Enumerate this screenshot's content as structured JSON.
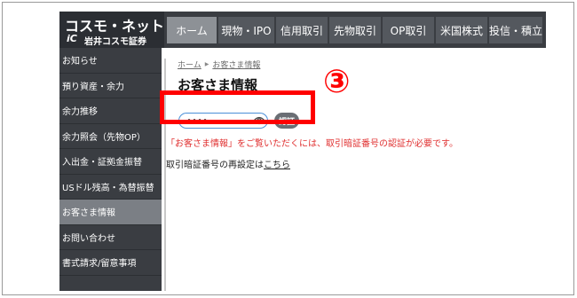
{
  "logo": {
    "main": "コスモ・ネットレ",
    "mark": "iC",
    "sub": "岩井コスモ証券"
  },
  "nav": {
    "tabs": [
      {
        "label": "ホーム",
        "active": true
      },
      {
        "label": "現物・IPO",
        "active": false
      },
      {
        "label": "信用取引",
        "active": false
      },
      {
        "label": "先物取引",
        "active": false
      },
      {
        "label": "OP取引",
        "active": false
      },
      {
        "label": "米国株式",
        "active": false
      },
      {
        "label": "投信・積立",
        "active": false
      }
    ]
  },
  "sidebar": {
    "items": [
      {
        "label": "お知らせ",
        "active": false
      },
      {
        "label": "預り資産・余力",
        "active": false
      },
      {
        "label": "余力推移",
        "active": false
      },
      {
        "label": "余力照会（先物OP）",
        "active": false
      },
      {
        "label": "入出金・証拠金振替",
        "active": false
      },
      {
        "label": "USドル残高・為替振替",
        "active": false
      },
      {
        "label": "お客さま情報",
        "active": true
      },
      {
        "label": "お問い合わせ",
        "active": false
      },
      {
        "label": "書式請求/留意事項",
        "active": false
      }
    ]
  },
  "main": {
    "breadcrumb": [
      "ホーム",
      "お客さま情報"
    ],
    "breadcrumb_separator": "▶",
    "title": "お客さま情報",
    "password_value": "••••",
    "auth_button": "認証",
    "error_message": "「お客さま情報」をご覧いただくには、取引暗証番号の認証が必要です。",
    "reset_prefix": "取引暗証番号の再設定は",
    "reset_link": "こちら"
  },
  "annotation": {
    "step": "③"
  },
  "colors": {
    "header_bg": "#3a3d42",
    "tab_bg": "#54585e",
    "tab_active_bg": "#8d9196",
    "sidebar_active_bg": "#7b7f85",
    "error_red": "#e03030",
    "annotation_red": "#ff0000",
    "input_border": "#4a8fd8"
  },
  "icons": {
    "password_toggle": "eye-icon"
  }
}
